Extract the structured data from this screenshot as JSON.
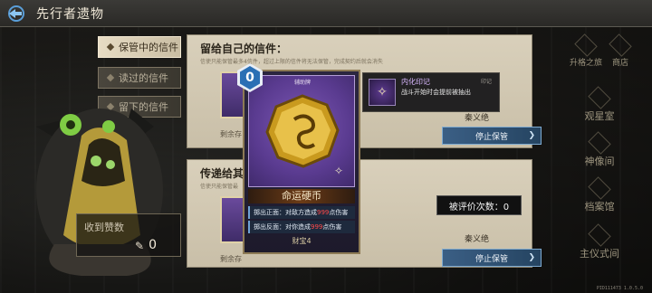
{
  "header": {
    "title": "先行者遗物"
  },
  "tabs": [
    {
      "label": "保管中的信件",
      "active": true
    },
    {
      "label": "读过的信件",
      "active": false
    },
    {
      "label": "留下的信件",
      "active": false
    }
  ],
  "received": {
    "label": "收到赞数",
    "count": "0"
  },
  "panel_top": {
    "title": "留给自己的信件：",
    "subtitle": "信使只能保管最多4信件，超过上限的信件将无法保管，完成契约后就会消失",
    "remain": "剩余存",
    "signature": "秦义绝",
    "stop_label": "停止保管"
  },
  "panel_bottom": {
    "title": "传递给其它",
    "subtitle": "信使只能保管最",
    "remain": "剩余存",
    "signature": "秦义绝",
    "stop_label": "停止保管",
    "eval_label": "被评价次数：0"
  },
  "card": {
    "cost": "0",
    "type": "辅助牌",
    "name": "命运硬币",
    "effects": [
      {
        "prefix": "掷出正面：对敌方造成",
        "value": "999",
        "suffix": "点伤害"
      },
      {
        "prefix": "掷出反面：对你造成",
        "value": "999",
        "suffix": "点伤害"
      }
    ],
    "footer": "财宝4",
    "footer_sub": "4"
  },
  "imprint": {
    "title": "内化印记",
    "tag": "印记",
    "desc": "战斗开始时会提前被抽出"
  },
  "right_nav": [
    {
      "label": "升格之旅",
      "icon": "ascension-icon"
    },
    {
      "label": "商店",
      "icon": "shop-icon"
    },
    {
      "label": "观星室",
      "icon": "observatory-icon"
    },
    {
      "label": "神像间",
      "icon": "statue-icon"
    },
    {
      "label": "档案馆",
      "icon": "archive-icon"
    },
    {
      "label": "主仪式间",
      "icon": "ritual-icon"
    }
  ],
  "version": "PID111473 1.0.5.0",
  "colors": {
    "accent_blue": "#2a6fb4",
    "card_purple": "#5a3b90",
    "damage_red": "#ff4a4a",
    "panel_beige": "#d9d0bb"
  }
}
